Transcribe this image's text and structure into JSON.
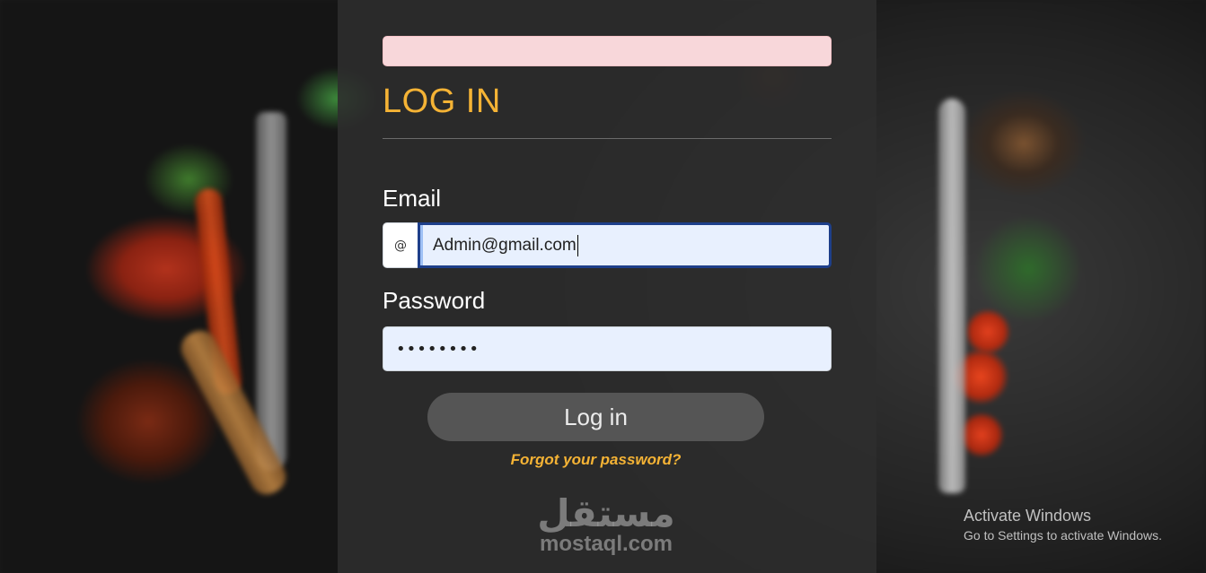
{
  "login": {
    "title": "LOG IN",
    "email_label": "Email",
    "email_prefix": "@",
    "email_value": "Admin@gmail.com",
    "password_label": "Password",
    "password_value": "••••••••",
    "submit_label": "Log in",
    "forgot_link": "Forgot your password?"
  },
  "watermark": {
    "arabic": "مستقل",
    "latin": "mostaql.com"
  },
  "os_notice": {
    "title": "Activate Windows",
    "subtitle": "Go to Settings to activate Windows."
  },
  "colors": {
    "accent": "#f5b335",
    "panel": "#2d2d2d",
    "button": "#555555",
    "alert_bg": "#f8d7da",
    "input_bg": "#e8f0fe"
  }
}
